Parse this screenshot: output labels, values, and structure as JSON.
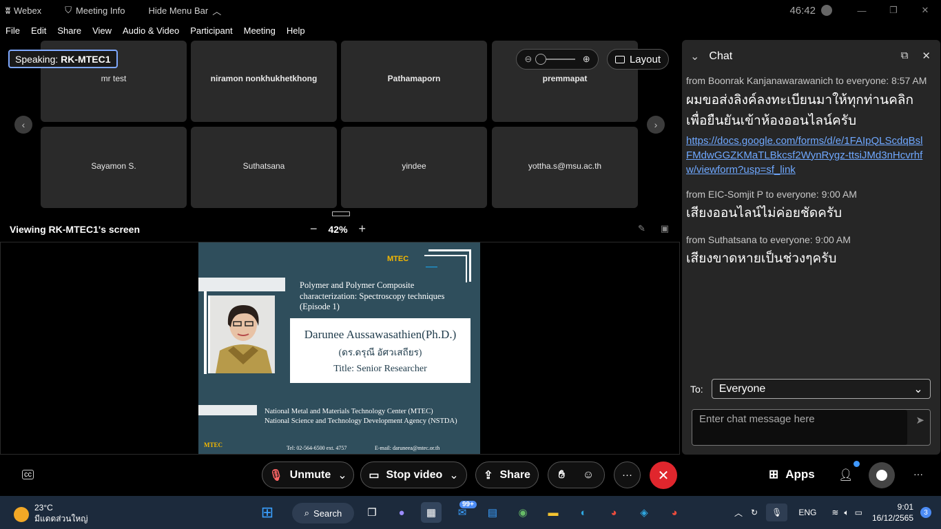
{
  "titlebar": {
    "app_name": "Webex",
    "meeting_info": "Meeting Info",
    "hide_menu": "Hide Menu Bar",
    "timer": "46:42"
  },
  "menu": [
    "File",
    "Edit",
    "Share",
    "View",
    "Audio & Video",
    "Participant",
    "Meeting",
    "Help"
  ],
  "speaking": {
    "label": "Speaking:",
    "name": "RK-MTEC1"
  },
  "participants_row1": [
    "mr test",
    "niramon nonkhukhetkhong",
    "Pathamaporn",
    "premmapat"
  ],
  "participants_row2": [
    "Sayamon S.",
    "Suthatsana",
    "yindee",
    "yottha.s@msu.ac.th"
  ],
  "layout_button": "Layout",
  "viewing": {
    "label": "Viewing RK-MTEC1's screen",
    "zoom": "42%"
  },
  "slide": {
    "title_line1": "Polymer and Polymer Composite",
    "title_line2": "characterization: Spectroscopy techniques",
    "title_line3": "(Episode 1)",
    "name": "Darunee Aussawasathien(Ph.D.)",
    "thai_name": "(ดร.ดรุณี อัศวเสถียร)",
    "role": "Title: Senior Researcher",
    "org1": "National Metal and Materials Technology Center (MTEC)",
    "org2": "National Science and Technology Development Agency (NSTDA)",
    "tel": "Tel: 02-564-6500 ext. 4757",
    "email": "E-mail: daruneea@mtec.or.th",
    "logo": "MTEC"
  },
  "chat": {
    "title": "Chat",
    "messages": [
      {
        "meta": "from Boonrak Kanjanawarawanich to everyone:    8:57 AM",
        "text": "ผมขอส่งลิงค์ลงทะเบียนมาให้ทุกท่านคลิก เพื่อยืนยันเข้าห้องออนไลน์ครับ",
        "link": "https://docs.google.com/forms/d/e/1FAIpQLScdqBslFMdwGGZKMaTLBkcsf2WynRygz-ttsiJMd3nHcvrhfw/viewform?usp=sf_link"
      },
      {
        "meta": "from EIC-Somjit P to everyone:    9:00 AM",
        "text": "เสียงออนไลน์ไม่ค่อยชัดครับ"
      },
      {
        "meta": "from Suthatsana to everyone:    9:00 AM",
        "text": "เสียงขาดหายเป็นช่วงๆครับ"
      }
    ],
    "to_label": "To:",
    "to_value": "Everyone",
    "input_placeholder": "Enter chat message here"
  },
  "controls": {
    "unmute": "Unmute",
    "stop_video": "Stop video",
    "share": "Share",
    "apps": "Apps"
  },
  "taskbar": {
    "temp": "23°C",
    "weather_text": "มีแดดส่วนใหญ่",
    "search": "Search",
    "mail_badge": "99+",
    "lang": "ENG",
    "time": "9:01",
    "date": "16/12/2565",
    "notif_count": "3"
  },
  "colors": {
    "end_call": "#e0262d",
    "link": "#6fa8ff",
    "slide_bg": "#2f4e5c"
  }
}
